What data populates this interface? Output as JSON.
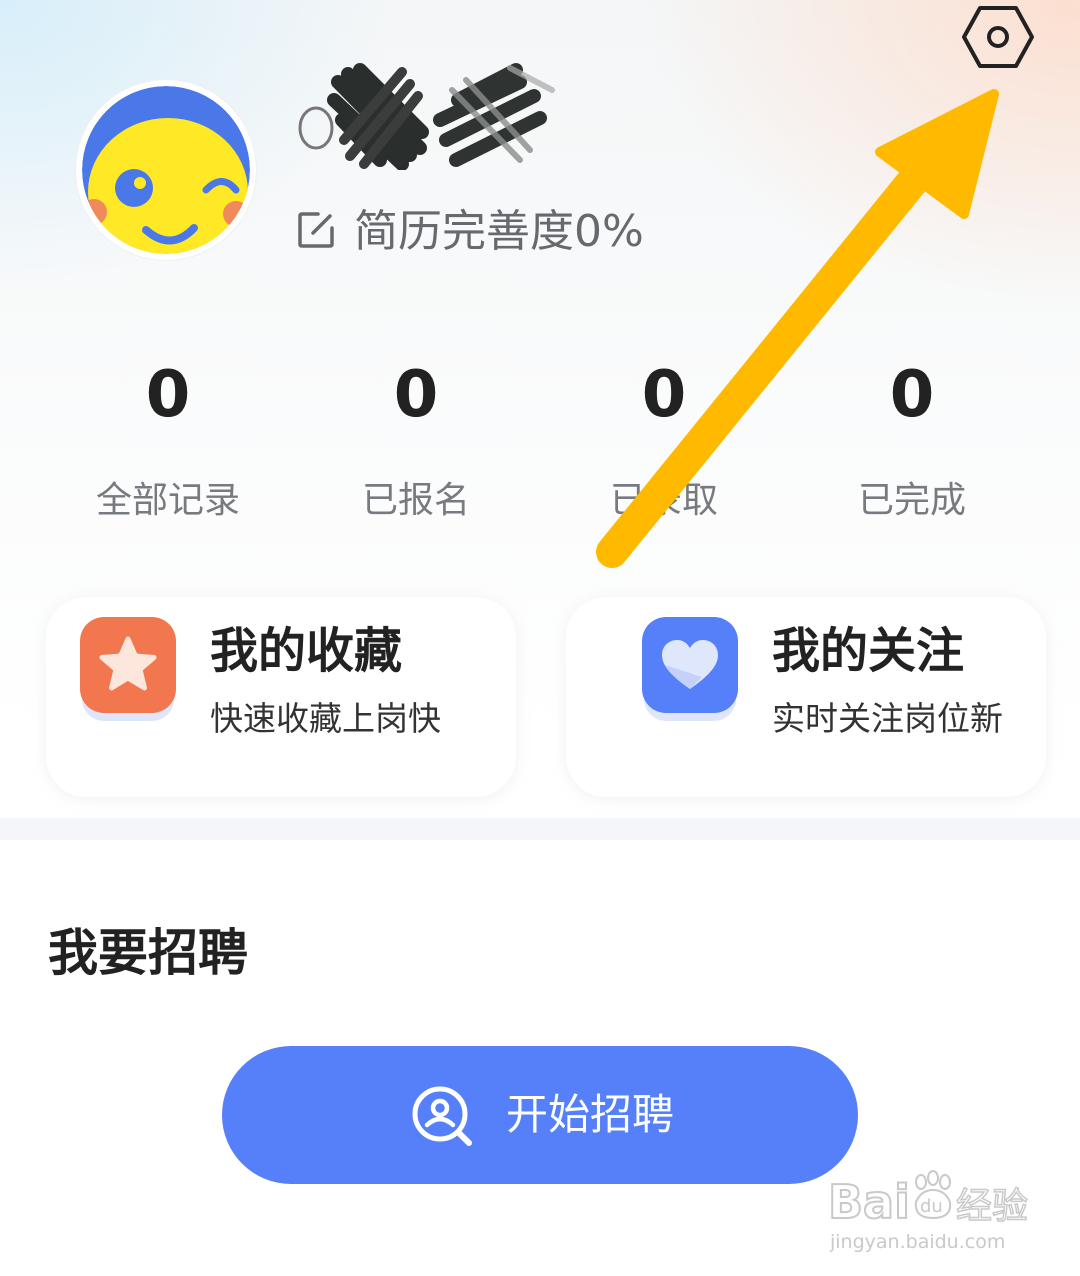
{
  "profile": {
    "resume_completion": "简历完善度0%"
  },
  "stats": [
    {
      "value": "0",
      "label": "全部记录"
    },
    {
      "value": "0",
      "label": "已报名"
    },
    {
      "value": "0",
      "label": "已录取"
    },
    {
      "value": "0",
      "label": "已完成"
    }
  ],
  "cards": [
    {
      "title": "我的收藏",
      "subtitle": "快速收藏上岗快",
      "icon": "star-icon",
      "color": "#f2774e"
    },
    {
      "title": "我的关注",
      "subtitle": "实时关注岗位新",
      "icon": "heart-icon",
      "color": "#5580fa"
    }
  ],
  "recruit": {
    "section_title": "我要招聘",
    "button_label": "开始招聘",
    "button_color": "#5580fa"
  },
  "watermark": {
    "brand": "Bai",
    "brand_suffix": "du",
    "product": "经验",
    "url": "jingyan.baidu.com"
  },
  "colors": {
    "annotation_arrow": "#ffba00"
  }
}
